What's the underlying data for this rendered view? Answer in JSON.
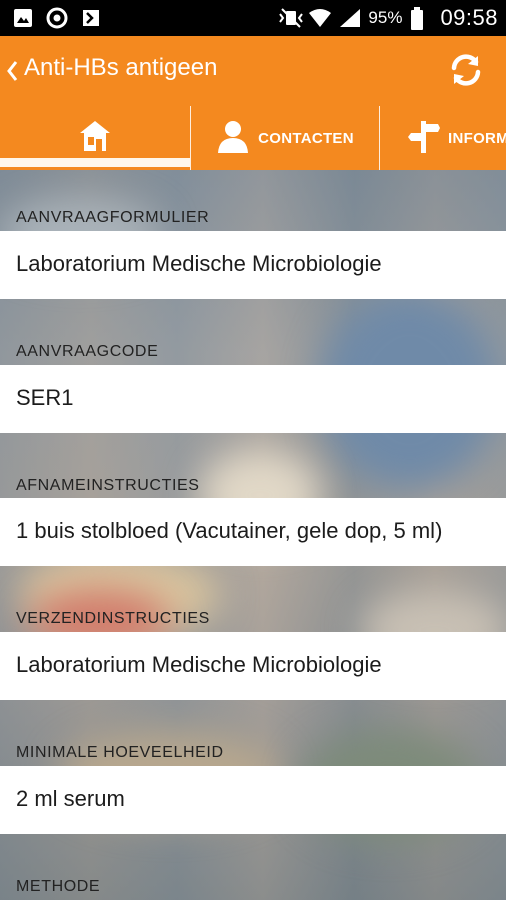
{
  "status_bar": {
    "left_icons": [
      "gallery-icon",
      "sync-circle-icon",
      "download-flag-icon"
    ],
    "right_icons": [
      "mute-vibrate-icon",
      "wifi-icon",
      "signal-icon"
    ],
    "battery": "95%",
    "time": "09:58"
  },
  "header": {
    "title": "Anti-HBs antigeen",
    "back_icon": "chevron-left-icon",
    "refresh_icon": "refresh-icon",
    "color": "#f4891f"
  },
  "tabs": [
    {
      "icon": "home-icon",
      "label": ""
    },
    {
      "icon": "person-icon",
      "label": "CONTACTEN"
    },
    {
      "icon": "signpost-icon",
      "label": "INFORM"
    }
  ],
  "sections": [
    {
      "label": "AANVRAAGFORMULIER",
      "value": "Laboratorium Medische Microbiologie"
    },
    {
      "label": "AANVRAAGCODE",
      "value": "SER1"
    },
    {
      "label": "AFNAMEINSTRUCTIES",
      "value": "1 buis stolbloed (Vacutainer, gele dop, 5 ml)"
    },
    {
      "label": "VERZENDINSTRUCTIES",
      "value": "Laboratorium Medische Microbiologie"
    },
    {
      "label": "MINIMALE HOEVEELHEID",
      "value": "2 ml serum"
    },
    {
      "label": "METHODE",
      "value": ""
    }
  ]
}
